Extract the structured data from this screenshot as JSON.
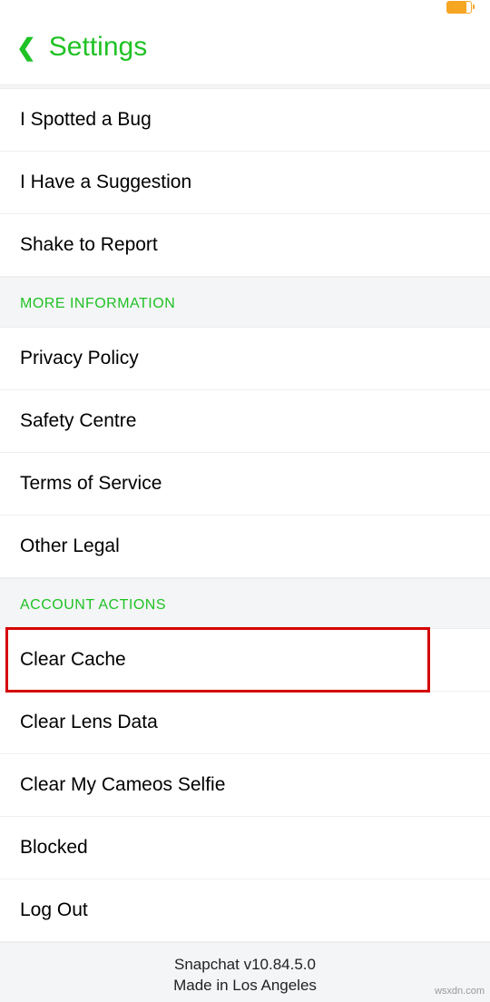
{
  "header": {
    "title": "Settings"
  },
  "feedback": {
    "items": [
      {
        "label": "I Spotted a Bug",
        "name": "item-spotted-bug"
      },
      {
        "label": "I Have a Suggestion",
        "name": "item-have-suggestion"
      },
      {
        "label": "Shake to Report",
        "name": "item-shake-to-report"
      }
    ]
  },
  "more_info": {
    "header": "MORE INFORMATION",
    "items": [
      {
        "label": "Privacy Policy",
        "name": "item-privacy-policy"
      },
      {
        "label": "Safety Centre",
        "name": "item-safety-centre"
      },
      {
        "label": "Terms of Service",
        "name": "item-terms-of-service"
      },
      {
        "label": "Other Legal",
        "name": "item-other-legal"
      }
    ]
  },
  "account_actions": {
    "header": "ACCOUNT ACTIONS",
    "items": [
      {
        "label": "Clear Cache",
        "name": "item-clear-cache",
        "highlighted": true
      },
      {
        "label": "Clear Lens Data",
        "name": "item-clear-lens-data"
      },
      {
        "label": "Clear My Cameos Selfie",
        "name": "item-clear-cameos-selfie"
      },
      {
        "label": "Blocked",
        "name": "item-blocked"
      },
      {
        "label": "Log Out",
        "name": "item-log-out"
      }
    ]
  },
  "footer": {
    "version": "Snapchat v10.84.5.0",
    "made_in": "Made in Los Angeles"
  },
  "watermark": "wsxdn.com"
}
